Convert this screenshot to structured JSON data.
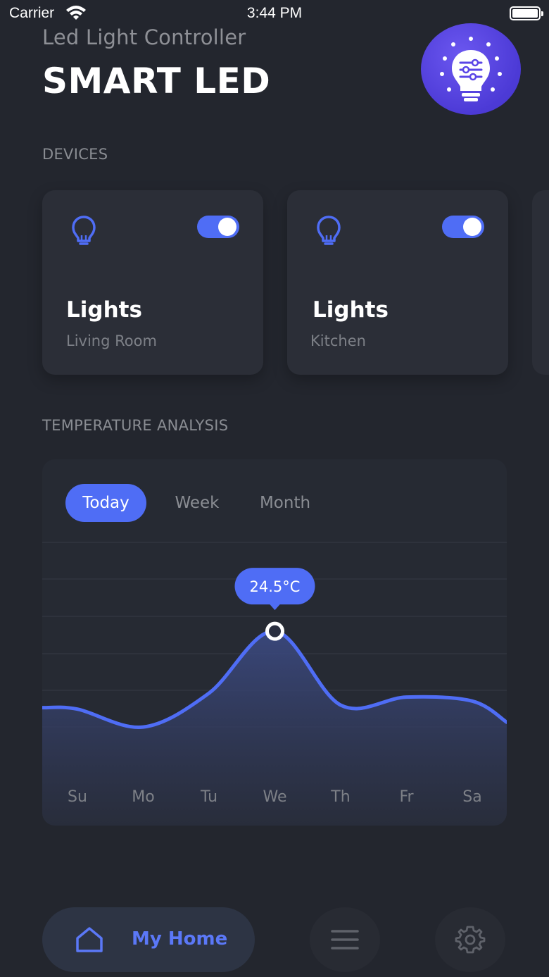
{
  "status_bar": {
    "carrier": "Carrier",
    "time": "3:44 PM"
  },
  "header": {
    "subtitle": "Led Light Controller",
    "title": "SMART LED",
    "logo_icon": "bulb-sliders-icon"
  },
  "devices": {
    "section_label": "DEVICES",
    "items": [
      {
        "name": "Lights",
        "room": "Living Room",
        "on": true,
        "icon": "bulb-icon"
      },
      {
        "name": "Lights",
        "room": "Kitchen",
        "on": true,
        "icon": "bulb-icon"
      }
    ]
  },
  "temperature": {
    "section_label": "TEMPERATURE ANALYSIS",
    "tabs": [
      {
        "label": "Today",
        "active": true
      },
      {
        "label": "Week",
        "active": false
      },
      {
        "label": "Month",
        "active": false
      }
    ],
    "tooltip": "24.5°C"
  },
  "chart_data": {
    "type": "area",
    "categories": [
      "Su",
      "Mo",
      "Tu",
      "We",
      "Th",
      "Fr",
      "Sa"
    ],
    "values": [
      20.6,
      19.7,
      21.4,
      24.5,
      20.8,
      21.2,
      21.0
    ],
    "highlight_index": 3,
    "grid": true,
    "line_color": "#4f6df5"
  },
  "nav": {
    "home_label": "My Home",
    "items": [
      "home-icon",
      "menu-icon",
      "settings-icon"
    ]
  },
  "colors": {
    "accent": "#4f6df5",
    "background": "#23262e",
    "card": "#2b2e37",
    "logo": "#5a45e6"
  }
}
